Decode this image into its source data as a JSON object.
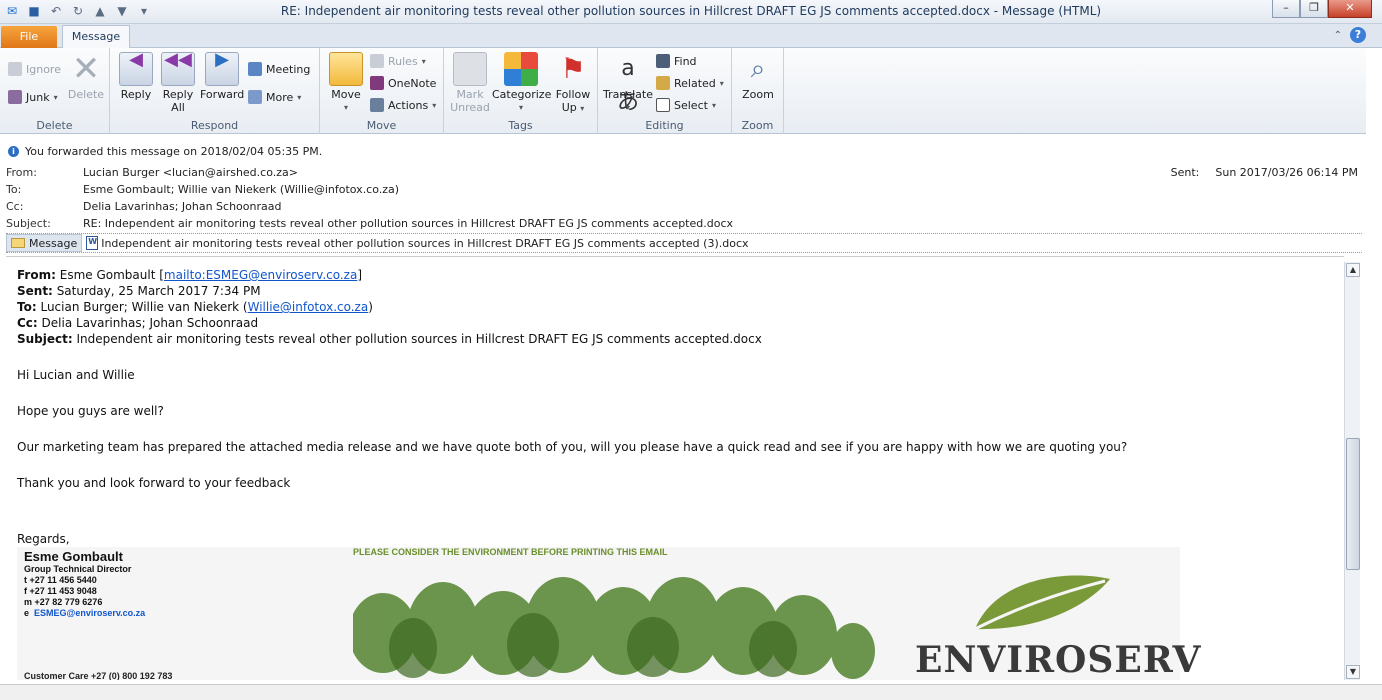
{
  "window": {
    "title": "RE: Independent air monitoring tests reveal other pollution sources in Hillcrest DRAFT EG JS comments accepted.docx  -  Message (HTML)"
  },
  "tabs": {
    "file": "File",
    "message": "Message"
  },
  "ribbon": {
    "delete_group": {
      "ignore": "Ignore",
      "junk": "Junk",
      "delete": "Delete",
      "label": "Delete"
    },
    "respond_group": {
      "reply": "Reply",
      "reply_all_1": "Reply",
      "reply_all_2": "All",
      "forward": "Forward",
      "meeting": "Meeting",
      "more": "More",
      "label": "Respond"
    },
    "move_group": {
      "move": "Move",
      "rules": "Rules",
      "onenote": "OneNote",
      "actions": "Actions",
      "label": "Move"
    },
    "tags_group": {
      "mark_unread_1": "Mark",
      "mark_unread_2": "Unread",
      "categorize": "Categorize",
      "follow_up_1": "Follow",
      "follow_up_2": "Up",
      "label": "Tags"
    },
    "editing_group": {
      "translate": "Translate",
      "find": "Find",
      "related": "Related",
      "select": "Select",
      "label": "Editing"
    },
    "zoom_group": {
      "zoom": "Zoom",
      "label": "Zoom"
    }
  },
  "header": {
    "info": "You forwarded this message on 2018/02/04 05:35 PM.",
    "from_label": "From:",
    "from": "Lucian Burger <lucian@airshed.co.za>",
    "to_label": "To:",
    "to": "Esme Gombault; Willie van Niekerk (Willie@infotox.co.za)",
    "cc_label": "Cc:",
    "cc": "Delia Lavarinhas; Johan Schoonraad",
    "subject_label": "Subject:",
    "subject": "RE: Independent air monitoring tests reveal other pollution sources in Hillcrest DRAFT EG JS comments accepted.docx",
    "sent_label": "Sent:",
    "sent": "Sun 2017/03/26 06:14 PM"
  },
  "attachments": {
    "message_tab": "Message",
    "file": "Independent air monitoring tests reveal other pollution sources in Hillcrest DRAFT EG JS comments accepted (3).docx"
  },
  "body": {
    "from_label": "From:",
    "from_name": "Esme Gombault [",
    "from_link": "mailto:ESMEG@enviroserv.co.za",
    "from_end": "]",
    "sent_label": "Sent:",
    "sent": "Saturday, 25 March 2017 7:34 PM",
    "to_label": "To:",
    "to_text": "Lucian Burger; Willie van Niekerk (",
    "to_link": "Willie@infotox.co.za",
    "to_end": ")",
    "cc_label": "Cc:",
    "cc": "Delia Lavarinhas; Johan Schoonraad",
    "subject_label": "Subject:",
    "subject": "Independent air monitoring tests reveal other pollution sources in Hillcrest DRAFT EG JS comments accepted.docx",
    "greeting": "Hi Lucian and Willie",
    "line1": "Hope you guys are well?",
    "line2": "Our marketing team has prepared the attached media release and we have quote both of you, will you please have a quick read and see if you are happy with how we are quoting you?",
    "line3": "Thank you and look forward to your feedback",
    "regards": "Regards,"
  },
  "signature": {
    "name": "Esme Gombault",
    "title": "Group Technical Director",
    "t": "t   +27 11 456 5440",
    "f": "f   +27 11 453 9048",
    "m": "m +27 82 779 6276",
    "e_label": "e",
    "email": "ESMEG@enviroserv.co.za",
    "customer_care": "Customer Care +27 (0) 800 192 783",
    "note": "PLEASE CONSIDER THE ENVIRONMENT BEFORE PRINTING THIS EMAIL",
    "logo": "ENVIROSERV"
  },
  "colors": {
    "file_tab": "#e0761a",
    "link": "#1155cc",
    "note_green": "#6a8f2c"
  }
}
